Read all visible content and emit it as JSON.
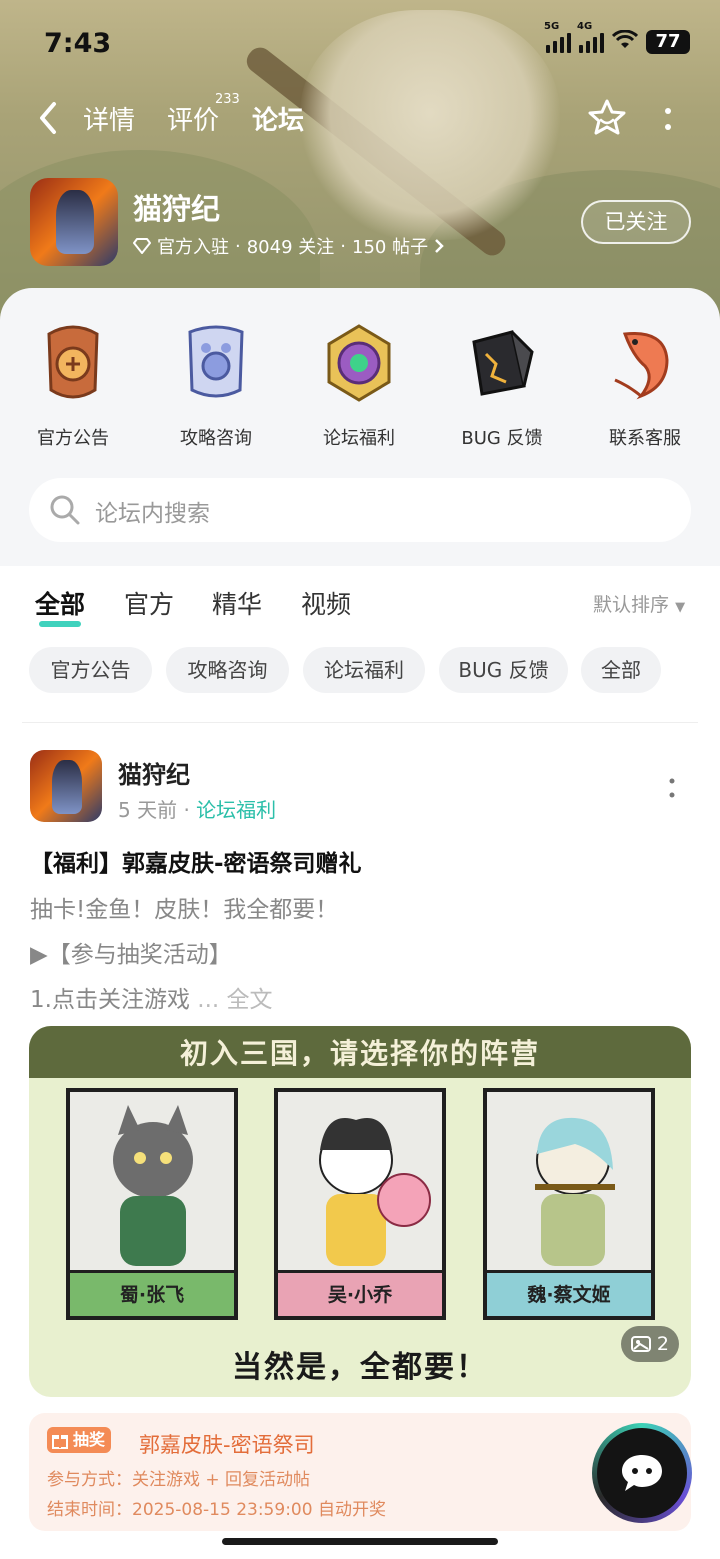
{
  "status_bar": {
    "time": "7:43",
    "net1": "5G",
    "net2": "4G",
    "battery": "77"
  },
  "nav": {
    "tabs": [
      {
        "label": "详情"
      },
      {
        "label": "评价",
        "badge": "233"
      },
      {
        "label": "论坛"
      }
    ]
  },
  "game": {
    "name": "猫狩纪",
    "badge": "官方入驻",
    "followers": "8049 关注",
    "posts": "150 帖子",
    "follow_label": "已关注"
  },
  "shortcuts": [
    {
      "label": "官方公告",
      "icon": "announcement-token-icon"
    },
    {
      "label": "攻略咨询",
      "icon": "guide-token-icon"
    },
    {
      "label": "论坛福利",
      "icon": "gift-medallion-icon"
    },
    {
      "label": "BUG 反馈",
      "icon": "bug-stone-icon"
    },
    {
      "label": "联系客服",
      "icon": "koi-fish-icon"
    }
  ],
  "search": {
    "placeholder": "论坛内搜索"
  },
  "feed": {
    "tabs": [
      "全部",
      "官方",
      "精华",
      "视频"
    ],
    "sort_label": "默认排序",
    "chips": [
      "官方公告",
      "攻略咨询",
      "论坛福利",
      "BUG 反馈",
      "全部"
    ]
  },
  "post": {
    "author": "猫狩纪",
    "time": "5 天前",
    "category": "论坛福利",
    "title": "【福利】郭嘉皮肤-密语祭司赠礼",
    "line1": "抽卡!金鱼！皮肤！我全都要！",
    "line2": "▶【参与抽奖活动】",
    "line3": "1.点击关注游戏",
    "more": "... 全文",
    "poster": {
      "headline": "初入三国，请选择你的阵营",
      "cards": [
        {
          "name": "蜀·张飞",
          "color": "#79b96b"
        },
        {
          "name": "吴·小乔",
          "color": "#e9a3b4"
        },
        {
          "name": "魏·蔡文姬",
          "color": "#8fcfd6"
        }
      ],
      "footer": "当然是，全都要！",
      "image_count": "2"
    },
    "lottery": {
      "tag": "抽奖",
      "title": "郭嘉皮肤-密语祭司",
      "method": "参与方式：关注游戏 + 回复活动帖",
      "end": "结束时间：2025-08-15 23:59:00 自动开奖"
    }
  },
  "colors": {
    "accent": "#3fd2bd",
    "category_text": "#2bbfa9",
    "lottery_orange": "#f48b55"
  }
}
